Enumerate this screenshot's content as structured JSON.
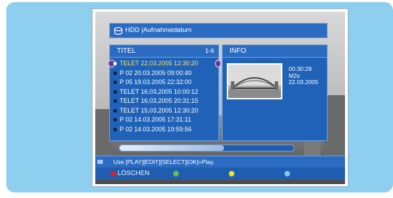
{
  "header": {
    "icon": "hdd-icon",
    "title": "HDD |Aufnahmedatum"
  },
  "title_panel": {
    "heading": "TITEL",
    "count": "1-6",
    "items": [
      "TELET 22,03,2005 12:30:20",
      "P 02 20.03.2005 09:00:40",
      "P 05 19.03.2005 22:32:00",
      "TELET 16,03,2005 10:00:12",
      "TELET 16,03,2005 20:31:15",
      "TELET 15,03,2005 12:30:20",
      "P 02 14.03.2005 17:31:11",
      "P 02 14.03.2005 19:59:56"
    ],
    "selected_index": 0
  },
  "info_panel": {
    "heading": "INFO",
    "duration": "00:30:28",
    "channel": "M2x",
    "date": "22.03.2005"
  },
  "progress": {
    "fraction": 0.6
  },
  "help": {
    "text": "Use [PLAY][EDIT][SELECT][OK]=Play."
  },
  "color_keys": {
    "red_label": "LÖSCHEN",
    "colors": {
      "red": "#e0202a",
      "green": "#6cc04a",
      "yellow": "#f2e21a",
      "blue": "#8ec2ee"
    }
  },
  "colors": {
    "outer_bg": "#8ecff0",
    "panel": "#1f62b8",
    "header": "#2b6cc2",
    "selected_text": "#f6e35a"
  }
}
